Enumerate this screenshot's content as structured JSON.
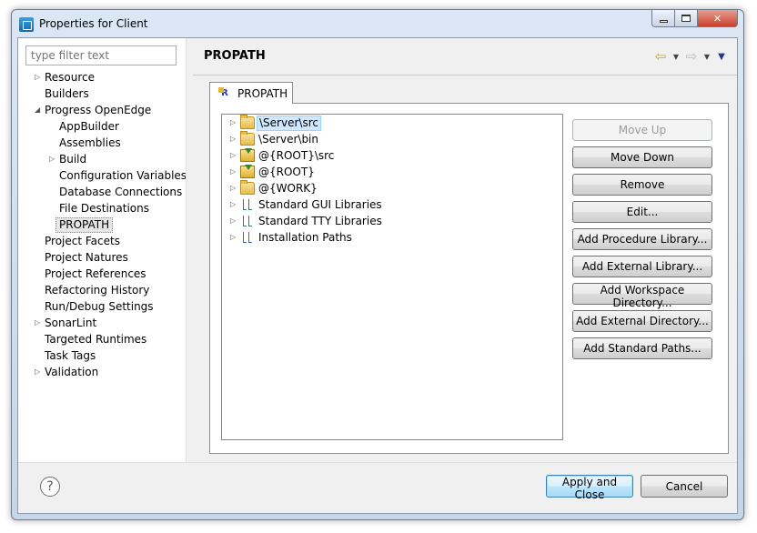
{
  "window": {
    "title": "Properties for Client"
  },
  "filter": {
    "placeholder": "type filter text"
  },
  "nav_tree": [
    {
      "label": "Resource",
      "level": 0,
      "expandable": true
    },
    {
      "label": "Builders",
      "level": 0,
      "expandable": false
    },
    {
      "label": "Progress OpenEdge",
      "level": 0,
      "expandable": true,
      "expanded": true
    },
    {
      "label": "AppBuilder",
      "level": 1,
      "expandable": false
    },
    {
      "label": "Assemblies",
      "level": 1,
      "expandable": false
    },
    {
      "label": "Build",
      "level": 1,
      "expandable": true
    },
    {
      "label": "Configuration Variables",
      "level": 1,
      "expandable": false
    },
    {
      "label": "Database Connections",
      "level": 1,
      "expandable": false
    },
    {
      "label": "File Destinations",
      "level": 1,
      "expandable": false
    },
    {
      "label": "PROPATH",
      "level": 1,
      "expandable": false,
      "selected": true
    },
    {
      "label": "Project Facets",
      "level": 0,
      "expandable": false
    },
    {
      "label": "Project Natures",
      "level": 0,
      "expandable": false
    },
    {
      "label": "Project References",
      "level": 0,
      "expandable": false
    },
    {
      "label": "Refactoring History",
      "level": 0,
      "expandable": false
    },
    {
      "label": "Run/Debug Settings",
      "level": 0,
      "expandable": false
    },
    {
      "label": "SonarLint",
      "level": 0,
      "expandable": true
    },
    {
      "label": "Targeted Runtimes",
      "level": 0,
      "expandable": false
    },
    {
      "label": "Task Tags",
      "level": 0,
      "expandable": false
    },
    {
      "label": "Validation",
      "level": 0,
      "expandable": true
    }
  ],
  "page": {
    "title": "PROPATH",
    "tab_label": "PROPATH",
    "tab_icon_letter": "R"
  },
  "propath_entries": [
    {
      "label": "\\Server\\src",
      "icon": "folder-icon",
      "selected": true
    },
    {
      "label": "\\Server\\bin",
      "icon": "folder-icon"
    },
    {
      "label": "@{ROOT}\\src",
      "icon": "variable-folder-icon"
    },
    {
      "label": "@{ROOT}",
      "icon": "variable-folder-icon"
    },
    {
      "label": "@{WORK}",
      "icon": "folder-icon"
    },
    {
      "label": "Standard GUI Libraries",
      "icon": "library-icon"
    },
    {
      "label": "Standard TTY Libraries",
      "icon": "library-icon"
    },
    {
      "label": "Installation Paths",
      "icon": "library-icon"
    }
  ],
  "buttons": [
    {
      "label": "Move Up",
      "enabled": false
    },
    {
      "label": "Move Down",
      "enabled": true
    },
    {
      "label": "Remove",
      "enabled": true
    },
    {
      "label": "Edit...",
      "enabled": true
    },
    {
      "label": "Add Procedure Library...",
      "enabled": true
    },
    {
      "label": "Add External Library...",
      "enabled": true
    },
    {
      "label": "Add Workspace Directory...",
      "enabled": true
    },
    {
      "label": "Add External Directory...",
      "enabled": true
    },
    {
      "label": "Add Standard Paths...",
      "enabled": true
    }
  ],
  "footer": {
    "help_glyph": "?",
    "apply_close_label": "Apply and Close",
    "cancel_label": "Cancel"
  },
  "colors": {
    "accent": "#3c7fb1",
    "selection": "#cde8ff",
    "nav_arrow": "#d4a21e"
  }
}
